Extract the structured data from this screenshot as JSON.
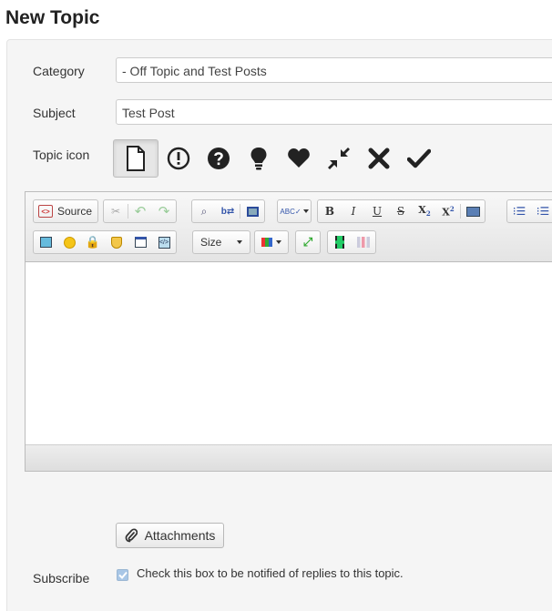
{
  "page": {
    "title": "New Topic"
  },
  "form": {
    "category": {
      "label": "Category",
      "value": "- Off Topic and Test Posts"
    },
    "subject": {
      "label": "Subject",
      "value": "Test Post"
    },
    "topic_icon": {
      "label": "Topic icon",
      "options": [
        "default-icon",
        "exclamation-icon",
        "question-icon",
        "idea-icon",
        "love-icon",
        "merge-icon",
        "cancel-icon",
        "solved-icon"
      ],
      "selected": "default-icon"
    },
    "attachments_label": "Attachments",
    "subscribe": {
      "label": "Subscribe",
      "checked": true,
      "text": "Check this box to be notified of replies to this topic."
    }
  },
  "editor": {
    "source_label": "Source",
    "size_label": "Size",
    "formatting": {
      "bold": "B",
      "italic": "I",
      "underline": "U",
      "strike": "S",
      "subscript": "X",
      "sub_mark": "2",
      "superscript": "X",
      "sup_mark": "2"
    }
  },
  "colors": {
    "selected_bg": "#e6e6e6",
    "panel_bg": "#f5f5f5",
    "checkbox": "#a8c6e6"
  }
}
